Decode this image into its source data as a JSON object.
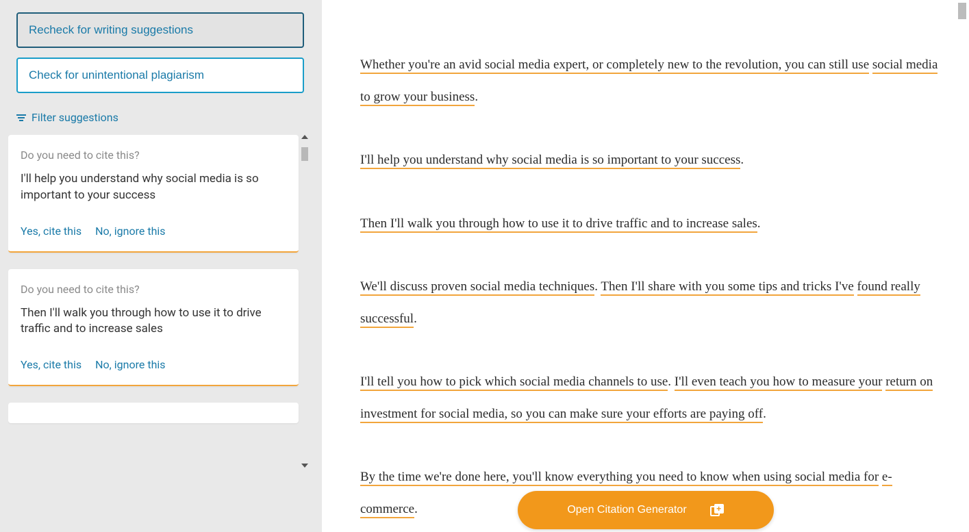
{
  "sidebar": {
    "recheck_label": "Recheck for writing suggestions",
    "plagiarism_label": "Check for unintentional plagiarism",
    "filter_label": "Filter suggestions"
  },
  "cards": [
    {
      "question": "Do you need to cite this?",
      "text": "I'll help you understand why social media is so important to your success",
      "yes": "Yes, cite this",
      "no": "No, ignore this"
    },
    {
      "question": "Do you need to cite this?",
      "text": "Then I'll walk you through how to use it to drive traffic and to increase sales",
      "yes": "Yes, cite this",
      "no": "No, ignore this"
    }
  ],
  "document": {
    "p1a": "Whether you're an avid social media expert, or completely new to the revolution, you can still use",
    "p1b": "social media to grow your business",
    "p1c": ".",
    "p2a": "I'll help you understand why social media is so important to your success",
    "p2b": ".",
    "p3a": "Then I'll walk you through how to use it to drive traffic and to increase sales",
    "p3b": ".",
    "p4a": "We'll discuss proven social media techniques",
    "p4b": ". ",
    "p4c": "Then I'll share with you some tips and tricks I've",
    "p4d": "found really successful",
    "p4e": ".",
    "p5a": "I'll tell you how to pick which social media channels to use",
    "p5b": ". ",
    "p5c": "I'll even teach you how to measure your",
    "p5d": "return on investment for social media, so you can make sure your efforts are paying off",
    "p5e": ".",
    "p6a": "By the time we're done here, you'll know everything you need to know when using social media for",
    "p6b": "e-commerce",
    "p6c": "."
  },
  "cta_label": "Open Citation Generator"
}
